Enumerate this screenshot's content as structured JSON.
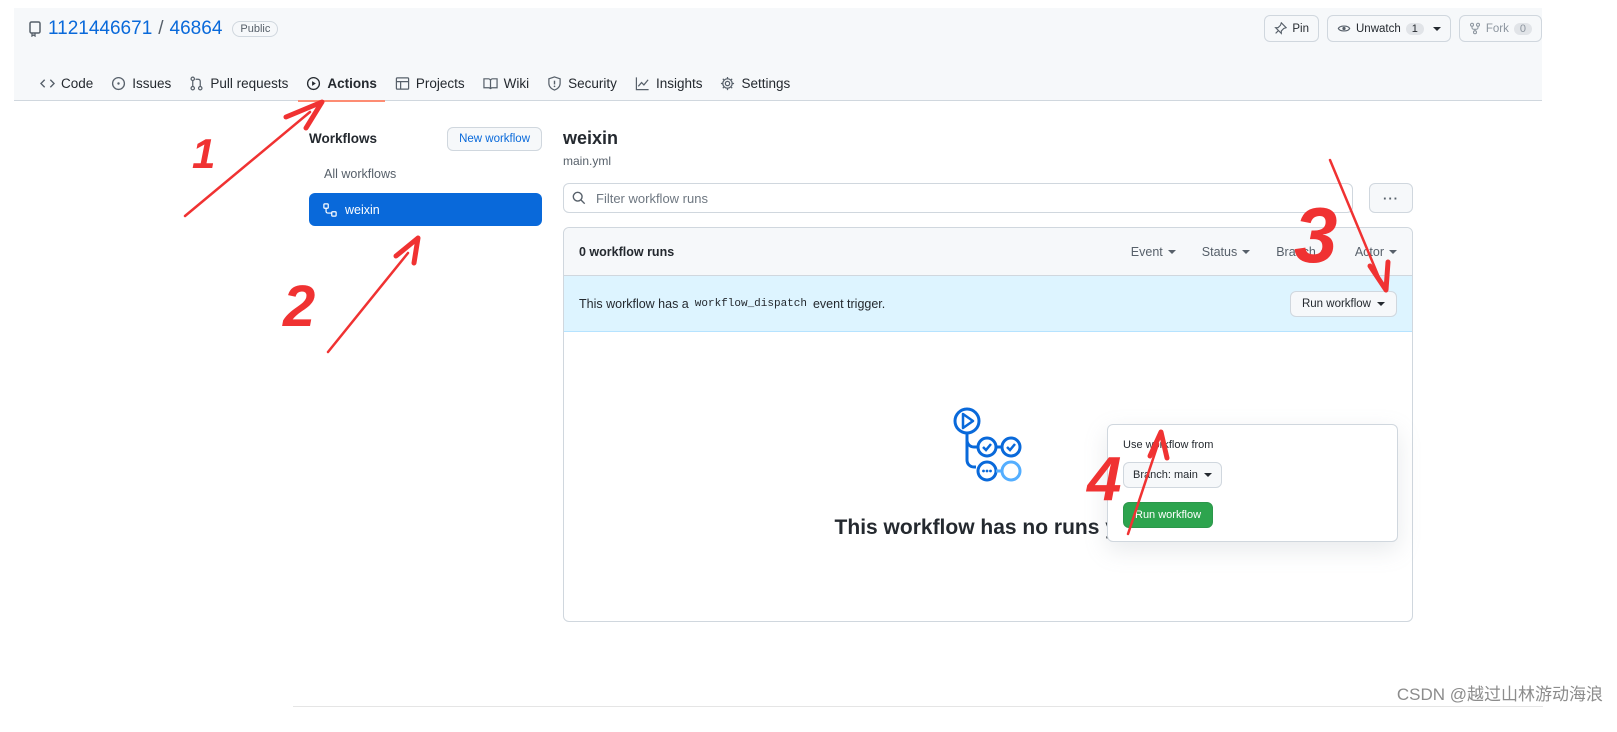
{
  "repo": {
    "owner": "1121446671",
    "separator": "/",
    "name": "46864",
    "visibility": "Public",
    "pin_label": "Pin",
    "unwatch_label": "Unwatch",
    "unwatch_count": "1",
    "fork_label": "Fork",
    "fork_count": "0"
  },
  "nav": {
    "tabs": [
      {
        "label": "Code",
        "icon": "code-icon"
      },
      {
        "label": "Issues",
        "icon": "issue-icon"
      },
      {
        "label": "Pull requests",
        "icon": "pull-request-icon"
      },
      {
        "label": "Actions",
        "icon": "play-icon",
        "active": true
      },
      {
        "label": "Projects",
        "icon": "table-icon"
      },
      {
        "label": "Wiki",
        "icon": "book-icon"
      },
      {
        "label": "Security",
        "icon": "shield-icon"
      },
      {
        "label": "Insights",
        "icon": "graph-icon"
      },
      {
        "label": "Settings",
        "icon": "gear-icon"
      }
    ]
  },
  "sidebar": {
    "title": "Workflows",
    "new_button": "New workflow",
    "all_workflows": "All workflows",
    "active_workflow": "weixin"
  },
  "main": {
    "workflow_title": "weixin",
    "workflow_file": "main.yml",
    "filter_placeholder": "Filter workflow runs",
    "more_label": "···",
    "runs_count": "0 workflow runs",
    "filters": [
      "Event",
      "Status",
      "Branch",
      "Actor"
    ],
    "dispatch_prefix": "This workflow has a",
    "dispatch_code": "workflow_dispatch",
    "dispatch_suffix": "event trigger.",
    "run_workflow_button": "Run workflow",
    "empty_message": "This workflow has no runs yet."
  },
  "popover": {
    "label": "Use workflow from",
    "branch_button": "Branch: main",
    "run_button": "Run workflow"
  },
  "annotations": {
    "marks": [
      "1",
      "2",
      "3",
      "4"
    ],
    "color": "#f03232"
  },
  "watermark": "CSDN @越过山林游动海浪",
  "colors": {
    "accent": "#0969da",
    "tab_underline": "#fd8c73",
    "green": "#2da44e",
    "dispatch_bg": "#ddf4ff"
  }
}
